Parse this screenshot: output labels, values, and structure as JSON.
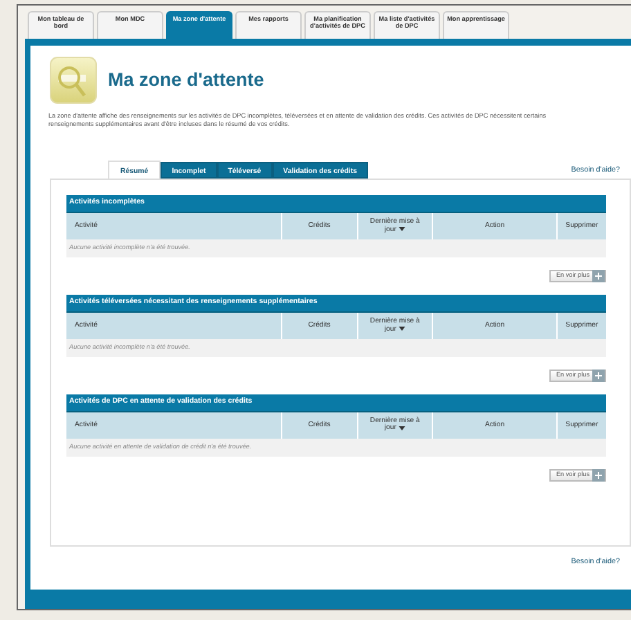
{
  "tabs": [
    {
      "label": "Mon tableau de bord",
      "selected": false
    },
    {
      "label": "Mon MDC",
      "selected": false
    },
    {
      "label": "Ma zone d'attente",
      "selected": true
    },
    {
      "label": "Mes rapports",
      "selected": false
    },
    {
      "label": "Ma planification d'activités de DPC",
      "selected": false
    },
    {
      "label": "Ma liste d'activités de DPC",
      "selected": false
    },
    {
      "label": "Mon apprentissage",
      "selected": false
    }
  ],
  "page": {
    "title": "Ma zone d'attente",
    "description": "La zone d'attente affiche des renseignements sur les activités de DPC incomplètes, téléversées et en attente de validation des crédits. Ces activités de DPC nécessitent certains renseignements supplémentaires avant d'être incluses dans le résumé de vos crédits."
  },
  "subtabs": [
    {
      "label": "Résumé",
      "selected": true
    },
    {
      "label": "Incomplet",
      "selected": false
    },
    {
      "label": "Téléversé",
      "selected": false
    },
    {
      "label": "Validation des crédits",
      "selected": false
    }
  ],
  "help_top": "Besoin d'aide?",
  "sections": [
    {
      "title": "Activités incomplètes",
      "columns": [
        {
          "label": "Activité",
          "sorted": false
        },
        {
          "label": "Crédits",
          "sorted": false
        },
        {
          "label": "Dernière mise à jour",
          "sorted": true
        },
        {
          "label": "Action",
          "sorted": false
        },
        {
          "label": "Supprimer",
          "sorted": false
        }
      ],
      "empty_message": "Aucune activité incomplète n'a été trouvée.",
      "more_button": "En voir plus"
    },
    {
      "title": "Activités téléversées nécessitant des renseignements supplémentaires",
      "columns": [
        {
          "label": "Activité",
          "sorted": false
        },
        {
          "label": "Crédits",
          "sorted": false
        },
        {
          "label": "Dernière mise à jour",
          "sorted": true
        },
        {
          "label": "Action",
          "sorted": false
        },
        {
          "label": "Supprimer",
          "sorted": false
        }
      ],
      "empty_message": "Aucune activité incomplète n'a été trouvée.",
      "more_button": "En voir plus"
    },
    {
      "title": "Activités de DPC en attente de validation des crédits",
      "columns": [
        {
          "label": "Activité",
          "sorted": false
        },
        {
          "label": "Crédits",
          "sorted": false
        },
        {
          "label": "Dernière mise à jour",
          "sorted": true
        },
        {
          "label": "Action",
          "sorted": false
        },
        {
          "label": "Supprimer",
          "sorted": false
        }
      ],
      "empty_message": "Aucune activité en attente de validation de crédit n'a été trouvée.",
      "more_button": "En voir plus"
    }
  ],
  "help_bottom": "Besoin d'aide?"
}
